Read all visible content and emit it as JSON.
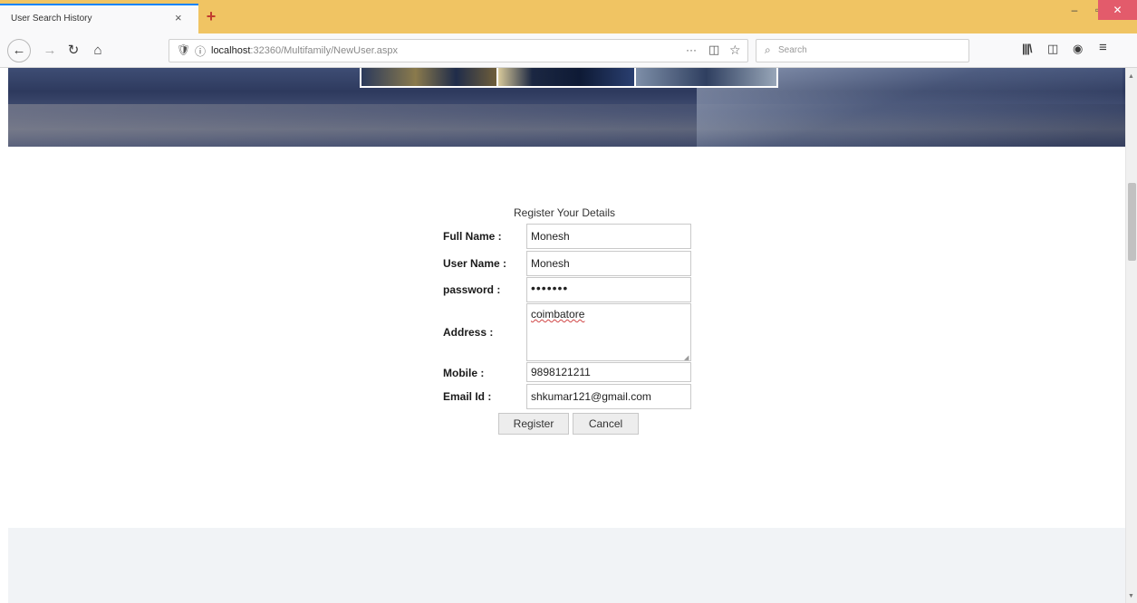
{
  "browser": {
    "tab_title": "User Search History",
    "tab_close": "×",
    "new_tab": "+",
    "window": {
      "minimize": "–",
      "maximize": "▫",
      "close": "✕"
    },
    "nav": {
      "back": "←",
      "forward": "→",
      "reload": "↻",
      "home": "⌂"
    },
    "url": {
      "host": "localhost",
      "rest": ":32360/Multifamily/NewUser.aspx",
      "shield_icon": "🛡",
      "info_icon": "ⓘ",
      "more": "···",
      "pocket": "◫",
      "star": "☆"
    },
    "search": {
      "icon": "⌕",
      "placeholder": "Search"
    },
    "toolbar": {
      "library": "|||\\",
      "sidebar": "◫",
      "account": "◉",
      "menu": "≡"
    },
    "accent": "#f0c463"
  },
  "form": {
    "title": "Register Your Details",
    "fields": [
      {
        "label": "Full Name :",
        "value": "Monesh"
      },
      {
        "label": "User Name :",
        "value": "Monesh"
      },
      {
        "label": "password :",
        "value": "•••••••"
      },
      {
        "label": "Address :",
        "value": "coimbatore"
      },
      {
        "label": "Mobile :",
        "value": "9898121211"
      },
      {
        "label": "Email Id :",
        "value": "shkumar121@gmail.com"
      }
    ],
    "register_label": "Register",
    "cancel_label": "Cancel"
  },
  "scrollbar": {
    "up": "▲",
    "down": "▼"
  }
}
